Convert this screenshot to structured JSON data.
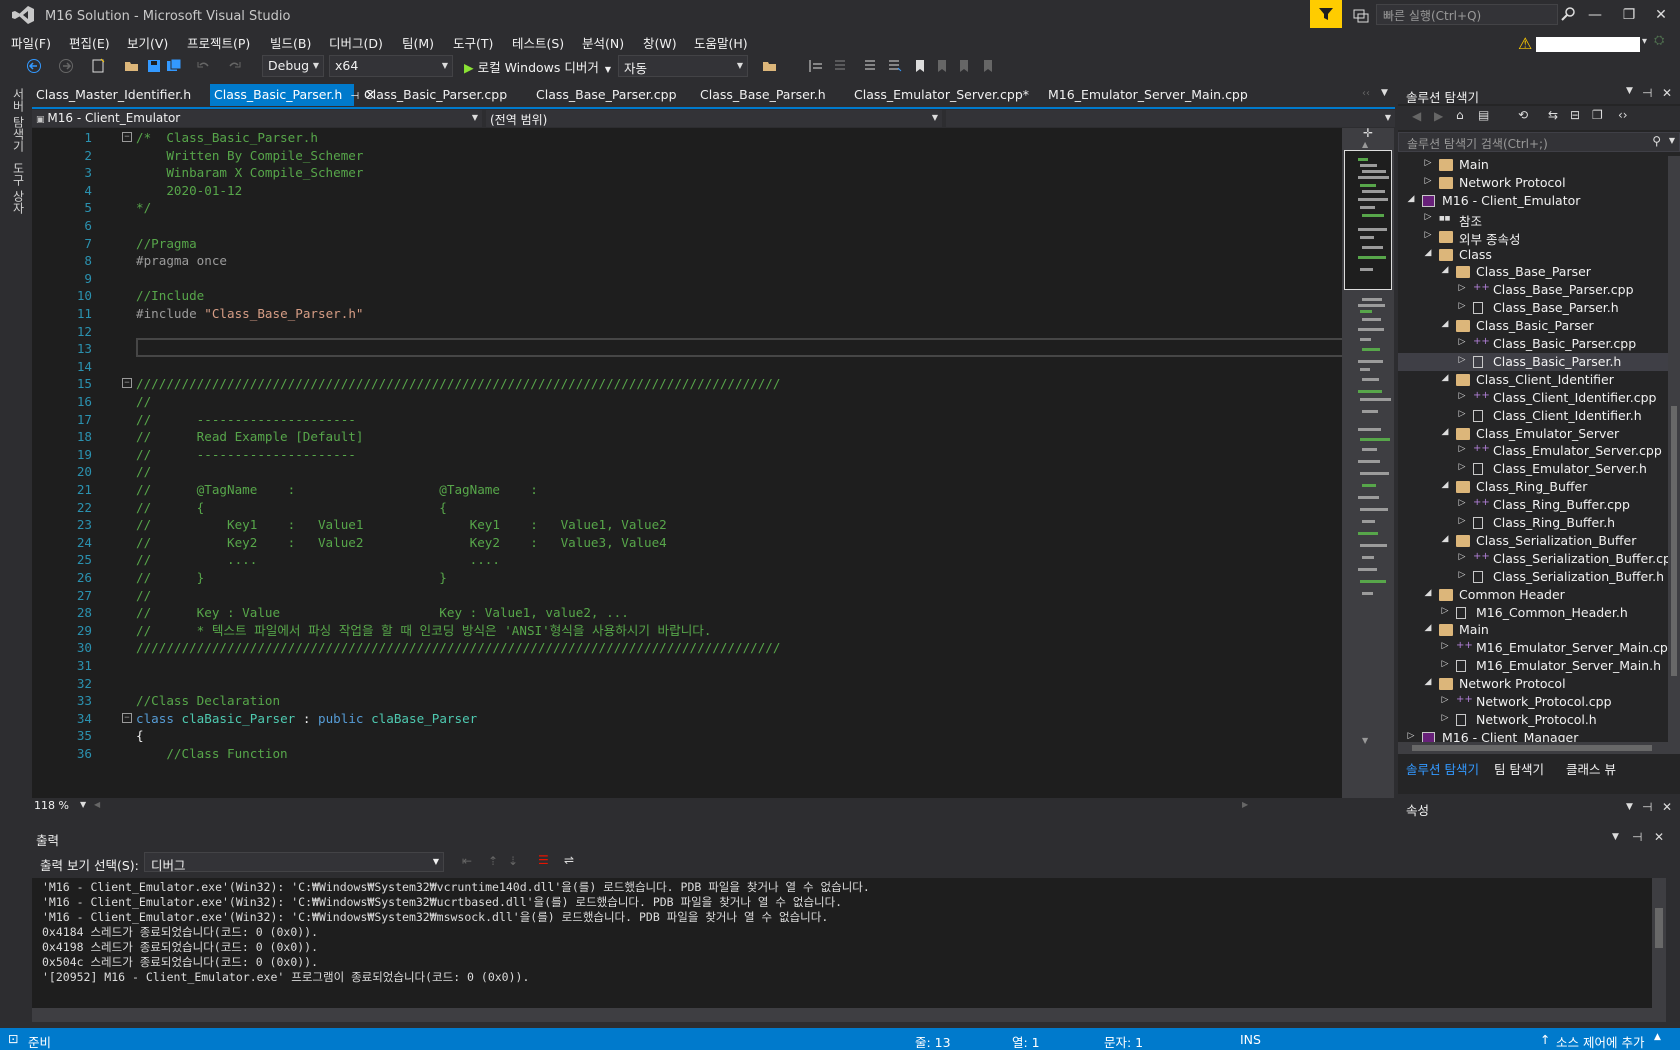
{
  "window": {
    "title": "M16 Solution - Microsoft Visual Studio",
    "quick_launch_placeholder": "빠른 실행(Ctrl+Q)"
  },
  "menu": [
    "파일(F)",
    "편집(E)",
    "보기(V)",
    "프로젝트(P)",
    "빌드(B)",
    "디버그(D)",
    "팀(M)",
    "도구(T)",
    "테스트(S)",
    "분석(N)",
    "창(W)",
    "도움말(H)"
  ],
  "toolbar": {
    "config": "Debug",
    "platform": "x64",
    "run_label": "로컬 Windows 디버거",
    "run_mode": "자동"
  },
  "left_strip": {
    "server_explorer": "서버 탐색기",
    "toolbox": "도구 상자"
  },
  "doc_tabs": [
    {
      "label": "Class_Master_Identifier.h"
    },
    {
      "label": "Class_Basic_Parser.h"
    },
    {
      "label": "Class_Basic_Parser.cpp"
    },
    {
      "label": "Class_Base_Parser.cpp"
    },
    {
      "label": "Class_Base_Parser.h"
    },
    {
      "label": "Class_Emulator_Server.cpp*"
    },
    {
      "label": "M16_Emulator_Server_Main.cpp"
    }
  ],
  "navbar": {
    "project": "M16 - Client_Emulator",
    "scope": "(전역 범위)",
    "member": ""
  },
  "editor": {
    "zoom": "118 %",
    "current_line": 13,
    "lines": [
      {
        "n": "1",
        "t": "/*  Class_Basic_Parser.h"
      },
      {
        "n": "2",
        "t": "    Written By Compile_Schemer"
      },
      {
        "n": "3",
        "t": "    Winbaram X Compile_Schemer"
      },
      {
        "n": "4",
        "t": "    2020-01-12"
      },
      {
        "n": "5",
        "t": "*/"
      },
      {
        "n": "6",
        "t": ""
      },
      {
        "n": "7",
        "t": "//Pragma"
      },
      {
        "n": "8",
        "t": "#pragma once"
      },
      {
        "n": "9",
        "t": ""
      },
      {
        "n": "10",
        "t": "//Include"
      },
      {
        "n": "11",
        "t": "#include \"Class_Base_Parser.h\""
      },
      {
        "n": "12",
        "t": ""
      },
      {
        "n": "13",
        "t": ""
      },
      {
        "n": "14",
        "t": ""
      },
      {
        "n": "15",
        "t": "/////////////////////////////////////////////////////////////////////////////////////"
      },
      {
        "n": "16",
        "t": "//"
      },
      {
        "n": "17",
        "t": "//      ---------------------"
      },
      {
        "n": "18",
        "t": "//      Read Example [Default]"
      },
      {
        "n": "19",
        "t": "//      ---------------------"
      },
      {
        "n": "20",
        "t": "//"
      },
      {
        "n": "21",
        "t": "//      @TagName    :                   @TagName    :"
      },
      {
        "n": "22",
        "t": "//      {                               {"
      },
      {
        "n": "23",
        "t": "//          Key1    :   Value1              Key1    :   Value1, Value2"
      },
      {
        "n": "24",
        "t": "//          Key2    :   Value2              Key2    :   Value3, Value4"
      },
      {
        "n": "25",
        "t": "//          ....                            ...."
      },
      {
        "n": "26",
        "t": "//      }                               }"
      },
      {
        "n": "27",
        "t": "//"
      },
      {
        "n": "28",
        "t": "//      Key : Value                     Key : Value1, value2, ..."
      },
      {
        "n": "29",
        "t": "//      * 텍스트 파일에서 파싱 작업을 할 때 인코딩 방식은 'ANSI'형식을 사용하시기 바랍니다."
      },
      {
        "n": "30",
        "t": "/////////////////////////////////////////////////////////////////////////////////////"
      },
      {
        "n": "31",
        "t": ""
      },
      {
        "n": "32",
        "t": ""
      },
      {
        "n": "33",
        "t": "//Class Declaration"
      },
      {
        "n": "34",
        "t": "class claBasic_Parser : public claBase_Parser"
      },
      {
        "n": "35",
        "t": "{"
      },
      {
        "n": "36",
        "t": "    //Class Function"
      }
    ]
  },
  "solution_explorer": {
    "title": "솔루션 탐색기",
    "search_placeholder": "솔루션 탐색기 검색(Ctrl+;)",
    "tree": [
      {
        "label": "Main",
        "kind": "folder",
        "depth": 2,
        "exp": "▷"
      },
      {
        "label": "Network Protocol",
        "kind": "folder",
        "depth": 2,
        "exp": "▷"
      },
      {
        "label": "M16 - Client_Emulator",
        "kind": "proj",
        "depth": 1,
        "exp": "◢"
      },
      {
        "label": "참조",
        "kind": "ref",
        "depth": 2,
        "exp": "▷"
      },
      {
        "label": "외부 종속성",
        "kind": "ext",
        "depth": 2,
        "exp": "▷"
      },
      {
        "label": "Class",
        "kind": "folder",
        "depth": 2,
        "exp": "◢"
      },
      {
        "label": "Class_Base_Parser",
        "kind": "folder",
        "depth": 3,
        "exp": "◢"
      },
      {
        "label": "Class_Base_Parser.cpp",
        "kind": "cpp",
        "depth": 4,
        "exp": "▷"
      },
      {
        "label": "Class_Base_Parser.h",
        "kind": "h",
        "depth": 4,
        "exp": "▷"
      },
      {
        "label": "Class_Basic_Parser",
        "kind": "folder",
        "depth": 3,
        "exp": "◢"
      },
      {
        "label": "Class_Basic_Parser.cpp",
        "kind": "cpp",
        "depth": 4,
        "exp": "▷"
      },
      {
        "label": "Class_Basic_Parser.h",
        "kind": "h",
        "depth": 4,
        "exp": "▷",
        "selected": true
      },
      {
        "label": "Class_Client_Identifier",
        "kind": "folder",
        "depth": 3,
        "exp": "◢"
      },
      {
        "label": "Class_Client_Identifier.cpp",
        "kind": "cpp",
        "depth": 4,
        "exp": "▷"
      },
      {
        "label": "Class_Client_Identifier.h",
        "kind": "h",
        "depth": 4,
        "exp": "▷"
      },
      {
        "label": "Class_Emulator_Server",
        "kind": "folder",
        "depth": 3,
        "exp": "◢"
      },
      {
        "label": "Class_Emulator_Server.cpp",
        "kind": "cpp",
        "depth": 4,
        "exp": "▷"
      },
      {
        "label": "Class_Emulator_Server.h",
        "kind": "h",
        "depth": 4,
        "exp": "▷"
      },
      {
        "label": "Class_Ring_Buffer",
        "kind": "folder",
        "depth": 3,
        "exp": "◢"
      },
      {
        "label": "Class_Ring_Buffer.cpp",
        "kind": "cpp",
        "depth": 4,
        "exp": "▷"
      },
      {
        "label": "Class_Ring_Buffer.h",
        "kind": "h",
        "depth": 4,
        "exp": "▷"
      },
      {
        "label": "Class_Serialization_Buffer",
        "kind": "folder",
        "depth": 3,
        "exp": "◢"
      },
      {
        "label": "Class_Serialization_Buffer.cp",
        "kind": "cpp",
        "depth": 4,
        "exp": "▷"
      },
      {
        "label": "Class_Serialization_Buffer.h",
        "kind": "h",
        "depth": 4,
        "exp": "▷"
      },
      {
        "label": "Common Header",
        "kind": "folder",
        "depth": 2,
        "exp": "◢"
      },
      {
        "label": "M16_Common_Header.h",
        "kind": "h",
        "depth": 3,
        "exp": "▷"
      },
      {
        "label": "Main",
        "kind": "folder",
        "depth": 2,
        "exp": "◢"
      },
      {
        "label": "M16_Emulator_Server_Main.cpp",
        "kind": "cpp",
        "depth": 3,
        "exp": "▷"
      },
      {
        "label": "M16_Emulator_Server_Main.h",
        "kind": "h",
        "depth": 3,
        "exp": "▷"
      },
      {
        "label": "Network Protocol",
        "kind": "folder",
        "depth": 2,
        "exp": "◢"
      },
      {
        "label": "Network_Protocol.cpp",
        "kind": "cpp",
        "depth": 3,
        "exp": "▷"
      },
      {
        "label": "Network_Protocol.h",
        "kind": "h",
        "depth": 3,
        "exp": "▷"
      },
      {
        "label": "M16 - Client_Manager",
        "kind": "proj",
        "depth": 1,
        "exp": "▷"
      }
    ],
    "bottom_tabs": [
      "솔루션 탐색기",
      "팀 탐색기",
      "클래스 뷰"
    ]
  },
  "properties": {
    "title": "속성"
  },
  "output": {
    "title": "출력",
    "source_label": "출력 보기 선택(S):",
    "source_value": "디버그",
    "lines": [
      "'M16 - Client_Emulator.exe'(Win32): 'C:₩Windows₩System32₩vcruntime140d.dll'을(를) 로드했습니다. PDB 파일을 찾거나 열 수 없습니다.",
      "'M16 - Client_Emulator.exe'(Win32): 'C:₩Windows₩System32₩ucrtbased.dll'을(를) 로드했습니다. PDB 파일을 찾거나 열 수 없습니다.",
      "'M16 - Client_Emulator.exe'(Win32): 'C:₩Windows₩System32₩mswsock.dll'을(를) 로드했습니다. PDB 파일을 찾거나 열 수 없습니다.",
      "0x4184 스레드가 종료되었습니다(코드: 0 (0x0)).",
      "0x4198 스레드가 종료되었습니다(코드: 0 (0x0)).",
      "0x504c 스레드가 종료되었습니다(코드: 0 (0x0)).",
      "'[20952] M16 - Client_Emulator.exe' 프로그램이 종료되었습니다(코드: 0 (0x0))."
    ]
  },
  "status": {
    "ready": "준비",
    "line": "줄: 13",
    "col": "열: 1",
    "ch": "문자: 1",
    "ins": "INS",
    "source_control": "소스 제어에 추가"
  },
  "colors": {
    "accent": "#007acc",
    "bg": "#1e1e1e",
    "comment": "#57a64a",
    "keyword": "#569cd6",
    "string": "#d69d85",
    "type": "#4ec9b0"
  }
}
